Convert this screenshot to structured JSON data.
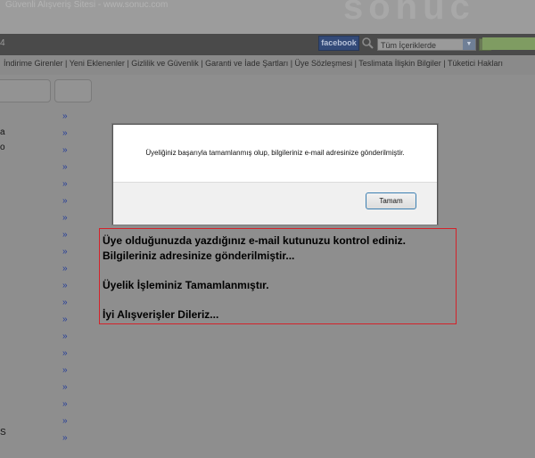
{
  "banner": {
    "tagline": "Güvenli Alışveriş Sitesi - www.sonuc.com",
    "logo_text": "sonuc"
  },
  "nav": {
    "counter": "4",
    "facebook_label": "facebook",
    "category_select_value": "Tüm İçeriklerde",
    "search_value": ""
  },
  "links": {
    "items": [
      "İndirime Girenler",
      "Yeni Eklenenler",
      "Gizlilik ve Güvenlik",
      "Garanti ve İade Şartları",
      "Üye Sözleşmesi",
      "Teslimata İlişkin Bilgiler",
      "Tüketici Hakları"
    ],
    "separator": "|"
  },
  "sidebar": {
    "chevron": "»",
    "chevron_count": 20,
    "fragments": [
      {
        "text": "a"
      },
      {
        "text": "o"
      },
      {
        "text": "S"
      }
    ]
  },
  "dialog": {
    "message": "Üyeliğiniz başarıyla tamamlanmış olup, bilgileriniz e-mail adresinize gönderilmiştir.",
    "ok_label": "Tamam"
  },
  "notice": {
    "line1": "Üye olduğunuzda yazdığınız e-mail kutunuzu kontrol ediniz.",
    "line2": "Bilgileriniz adresinize gönderilmiştir...",
    "line3": "Üyelik İşleminiz Tamamlanmıştır.",
    "line4": "İyi Alışverişler Dileriz..."
  },
  "colors": {
    "overlay": "#8e8e8e",
    "chevron": "#243d9a",
    "notice_border": "#d4222a",
    "button_border": "#3c7fb1"
  }
}
